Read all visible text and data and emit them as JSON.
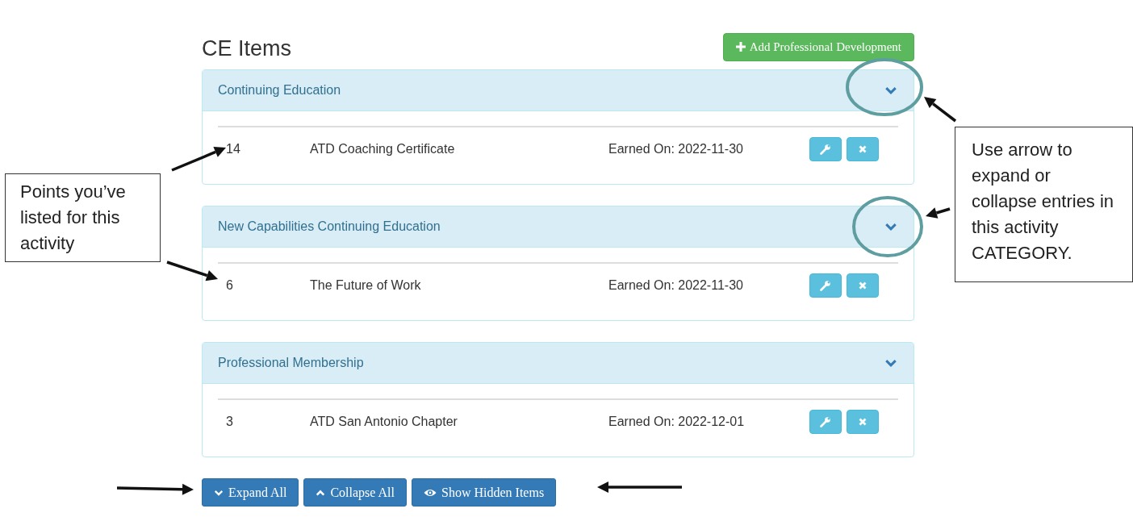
{
  "title": "CE Items",
  "add_button": {
    "label": "Add Professional Development"
  },
  "panels": [
    {
      "title": "Continuing Education",
      "expanded": true,
      "entries": [
        {
          "points": "14",
          "name": "ATD Coaching Certificate",
          "earned": "Earned On: 2022-11-30"
        }
      ]
    },
    {
      "title": "New Capabilities Continuing Education",
      "expanded": true,
      "entries": [
        {
          "points": "6",
          "name": "The Future of Work",
          "earned": "Earned On: 2022-11-30"
        }
      ]
    },
    {
      "title": "Professional Membership",
      "expanded": true,
      "entries": [
        {
          "points": "3",
          "name": "ATD San Antonio Chapter",
          "earned": "Earned On: 2022-12-01"
        }
      ]
    }
  ],
  "footer_buttons": [
    {
      "label": "Expand All",
      "kind": "expand"
    },
    {
      "label": "Collapse All",
      "kind": "collapse"
    },
    {
      "label": "Show Hidden Items",
      "kind": "show"
    }
  ],
  "callouts": [
    {
      "text": "Points you’ve listed for this activity",
      "kind": "left"
    },
    {
      "text": "Use arrow to expand or collapse entries in this activity CATEGORY.",
      "kind": "right"
    }
  ]
}
